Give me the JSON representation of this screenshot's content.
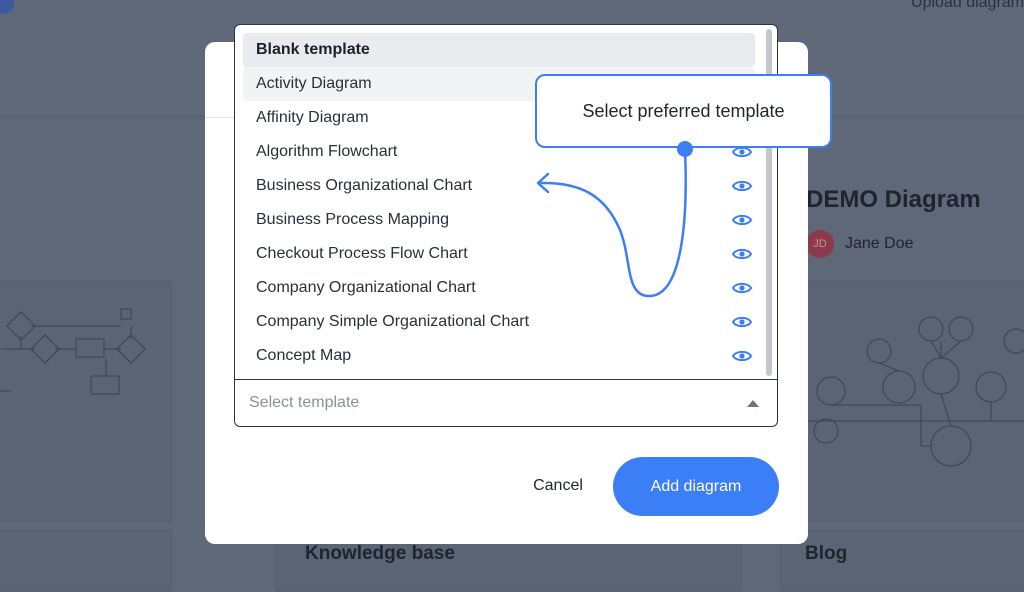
{
  "background": {
    "upload_label": "Upload diagram",
    "demo_title": "DEMO Diagram",
    "author_initials": "JD",
    "author_name": "Jane Doe",
    "section_knowledge": "Knowledge base",
    "section_blog": "Blog"
  },
  "dropdown": {
    "items": [
      {
        "label": "Blank template",
        "state": "selected",
        "preview": false
      },
      {
        "label": "Activity Diagram",
        "state": "hover",
        "preview": false
      },
      {
        "label": "Affinity Diagram",
        "state": "normal",
        "preview": false
      },
      {
        "label": "Algorithm Flowchart",
        "state": "normal",
        "preview": true
      },
      {
        "label": "Business Organizational Chart",
        "state": "normal",
        "preview": true
      },
      {
        "label": "Business Process Mapping",
        "state": "normal",
        "preview": true
      },
      {
        "label": "Checkout Process Flow Chart",
        "state": "normal",
        "preview": true
      },
      {
        "label": "Company Organizational Chart",
        "state": "normal",
        "preview": true
      },
      {
        "label": "Company Simple Organizational Chart",
        "state": "normal",
        "preview": true
      },
      {
        "label": "Concept Map",
        "state": "normal",
        "preview": true
      }
    ],
    "placeholder": "Select template",
    "preview_icon": "eye-icon",
    "caret_icon": "caret-up-icon"
  },
  "callout": {
    "text": "Select preferred template"
  },
  "modal": {
    "cancel_label": "Cancel",
    "add_label": "Add diagram"
  },
  "colors": {
    "accent": "#3c7ef6",
    "overlay": "#5f6878",
    "selected_bg": "#e9ebee"
  }
}
